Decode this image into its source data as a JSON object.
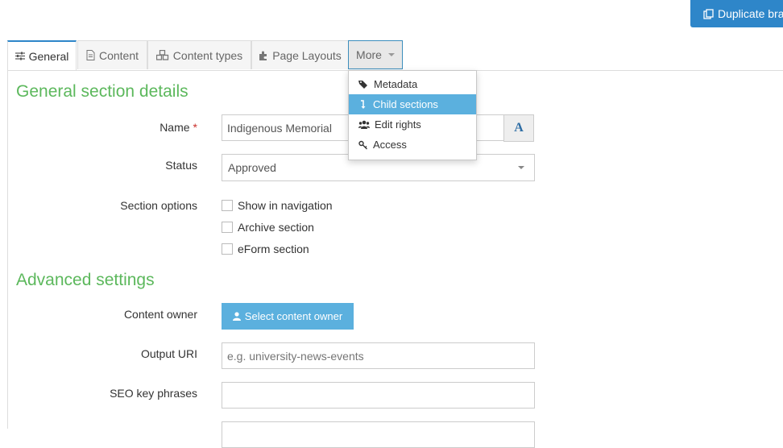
{
  "header": {
    "duplicate_label": "Duplicate bra"
  },
  "tabs": [
    {
      "label": "General",
      "icon": "sliders-icon"
    },
    {
      "label": "Content",
      "icon": "document-icon"
    },
    {
      "label": "Content types",
      "icon": "cubes-icon"
    },
    {
      "label": "Page Layouts",
      "icon": "puzzle-icon"
    },
    {
      "label": "More",
      "icon": "caret-down-icon"
    }
  ],
  "more_menu": [
    {
      "label": "Metadata",
      "icon": "tags-icon"
    },
    {
      "label": "Child sections",
      "icon": "level-down-icon"
    },
    {
      "label": "Edit rights",
      "icon": "users-icon"
    },
    {
      "label": "Access",
      "icon": "key-icon"
    }
  ],
  "general": {
    "title": "General section details",
    "name_label": "Name",
    "required_mark": "*",
    "name_value": "Indigenous Memorial",
    "translate_glyph": "A",
    "status_label": "Status",
    "status_value": "Approved",
    "options_label": "Section options",
    "options": [
      "Show in navigation",
      "Archive section",
      "eForm section"
    ]
  },
  "advanced": {
    "title": "Advanced settings",
    "owner_label": "Content owner",
    "owner_button": "Select content owner",
    "uri_label": "Output URI",
    "uri_placeholder": "e.g. university-news-events",
    "seo_label": "SEO key phrases"
  },
  "colors": {
    "accent": "#2e86c9",
    "heading": "#5cb85c",
    "button": "#5bb0de",
    "required": "#c9302c"
  }
}
